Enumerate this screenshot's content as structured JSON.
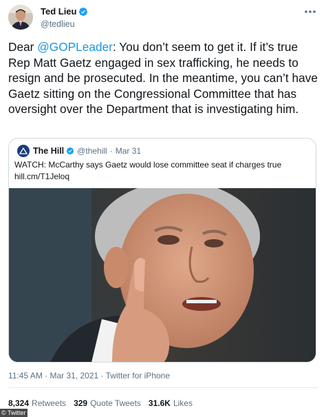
{
  "author": {
    "display_name": "Ted Lieu",
    "handle": "@tedlieu",
    "verified": true
  },
  "tweet": {
    "text_parts": [
      "Dear ",
      "@GOPLeader",
      ": You don’t seem to get it. If it’s true Rep Matt Gaetz engaged in sex trafficking, he needs to resign and be prosecuted. In the meantime, you can’t have Gaetz sitting on the Congressional Committee that has oversight over the Department that is investigating him."
    ]
  },
  "quote": {
    "display_name": "The Hill",
    "handle": "@thehill",
    "separator": "·",
    "date": "Mar 31",
    "text_line1": "WATCH: McCarthy says Gaetz would lose committee seat if charges true",
    "text_line2": "hill.cm/T1Jeloq"
  },
  "meta": {
    "text": "11:45 AM · Mar 31, 2021 · Twitter for iPhone"
  },
  "stats": {
    "retweets_count": "8,324",
    "retweets_label": "Retweets",
    "quotes_count": "329",
    "quotes_label": "Quote Tweets",
    "likes_count": "31.6K",
    "likes_label": "Likes"
  },
  "credit": "© Twitter",
  "colors": {
    "link": "#1b95e0",
    "verified": "#1da1f2",
    "secondary_text": "#5b7083",
    "border": "#cfd9de"
  },
  "icons": {
    "more": "more-dots-icon",
    "verified": "verified-badge-icon"
  }
}
